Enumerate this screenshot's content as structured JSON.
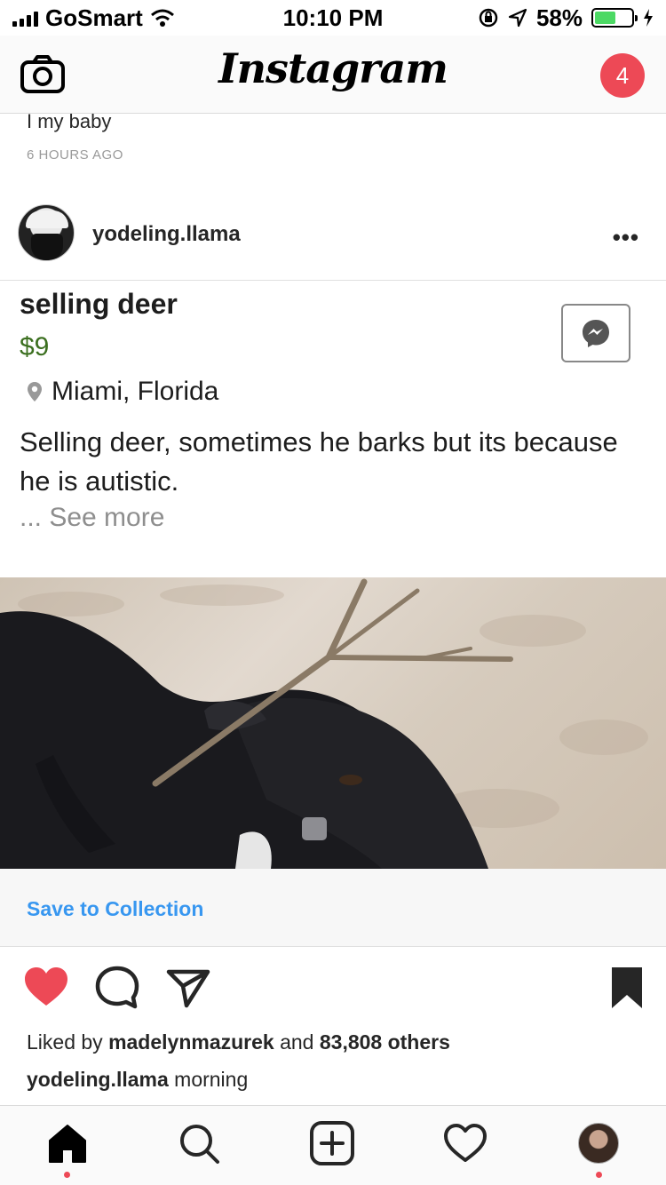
{
  "status_bar": {
    "carrier": "GoSmart",
    "time": "10:10 PM",
    "battery_percent": "58%",
    "battery_level": 0.58,
    "icons": [
      "signal-icon",
      "wifi-icon",
      "rotation-lock-icon",
      "location-icon",
      "battery-icon",
      "charging-icon"
    ]
  },
  "navbar": {
    "logo_text": "Instagram",
    "notification_count": "4",
    "icons": [
      "camera-icon"
    ]
  },
  "previous_post": {
    "caption": "I my baby",
    "time": "6 HOURS AGO"
  },
  "post": {
    "username": "yodeling.llama",
    "more_label": "•••",
    "marketplace": {
      "title": "selling deer",
      "price": "$9",
      "location": "Miami, Florida",
      "description": "Selling deer, sometimes he barks but its because he is autistic.",
      "see_more": "... See more"
    },
    "save_to_collection": "Save to Collection",
    "liked_prefix": "Liked by",
    "liked_user": "madelynmazurek",
    "liked_middle": "and",
    "liked_others": "83,808 others",
    "caption_user": "yodeling.llama",
    "caption_text": "morning"
  },
  "colors": {
    "like_red": "#ed4956",
    "link_blue": "#3897f0",
    "price_green": "#3b6f1f"
  },
  "tabbar": {
    "tabs": [
      "home-icon",
      "search-icon",
      "add-post-icon",
      "activity-heart-icon",
      "profile-avatar"
    ]
  }
}
